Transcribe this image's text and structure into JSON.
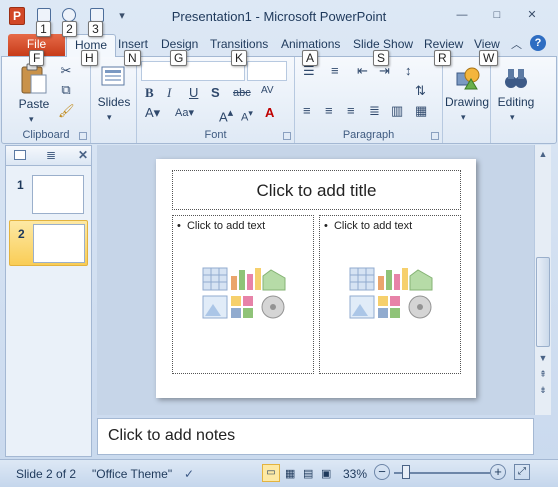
{
  "window": {
    "title": "Presentation1  -  Microsoft PowerPoint",
    "minimize_glyph": "—",
    "maximize_glyph": "□",
    "close_glyph": "✕"
  },
  "app_icon_letter": "P",
  "key_tips": {
    "qat1": "1",
    "qat2": "2",
    "qat3": "3",
    "file": "F",
    "home": "H",
    "insert": "N",
    "design": "G",
    "transitions": "K",
    "animations": "A",
    "slideshow": "S",
    "review": "R",
    "view": "W"
  },
  "tabs": {
    "file": "File",
    "home": "Home",
    "insert": "Insert",
    "design": "Design",
    "transitions": "Transitions",
    "animations": "Animations",
    "slideshow": "Slide Show",
    "review": "Review",
    "view": "View"
  },
  "ribbon": {
    "clipboard": {
      "label": "Clipboard",
      "paste": "Paste"
    },
    "slides": {
      "label": "Slides",
      "button": "Slides"
    },
    "font": {
      "label": "Font"
    },
    "paragraph": {
      "label": "Paragraph"
    },
    "drawing": {
      "button": "Drawing"
    },
    "editing": {
      "button": "Editing"
    }
  },
  "slides_panel": {
    "slides": [
      {
        "number": "1"
      },
      {
        "number": "2",
        "selected": true
      }
    ]
  },
  "slide": {
    "title_placeholder": "Click to add title",
    "left_content": "Click to add text",
    "right_content": "Click to add text"
  },
  "notes_placeholder": "Click to add notes",
  "status": {
    "slide_position": "Slide 2 of 2",
    "theme": "\"Office Theme\"",
    "zoom": "33%"
  },
  "colors": {
    "file_tab": "#d24726",
    "selected_thumb": "#f9cd56",
    "ribbon_bg": "#dfe9f5"
  }
}
